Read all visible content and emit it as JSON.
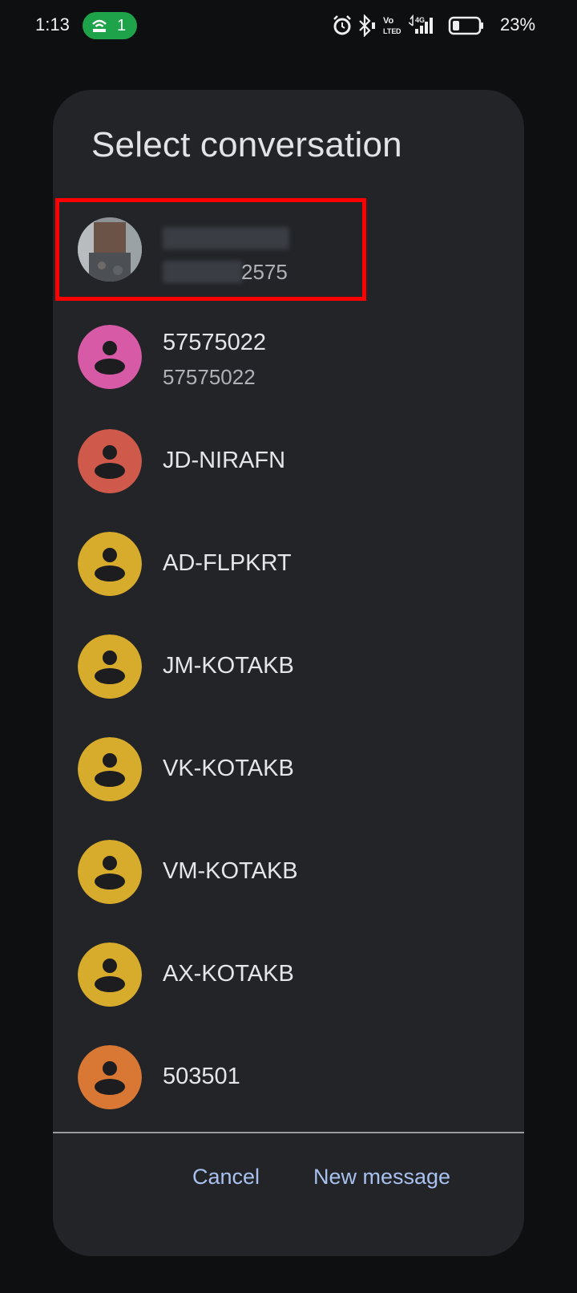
{
  "status_bar": {
    "time": "1:13",
    "hotspot_count": "1",
    "battery_percent": "23%",
    "icons": [
      "alarm-icon",
      "bluetooth-icon",
      "volte-icon",
      "4g-signal-icon",
      "battery-icon"
    ],
    "colors": {
      "hotspot_badge": "#1fa34a"
    }
  },
  "dialog": {
    "title": "Select conversation",
    "conversations": [
      {
        "name": "",
        "subtitle": "2575",
        "avatar": "photo",
        "highlighted": true
      },
      {
        "name": "57575022",
        "subtitle": "57575022",
        "avatar_color": "#d75aa6"
      },
      {
        "name": "JD-NIRAFN",
        "avatar_color": "#cf5a4c"
      },
      {
        "name": "AD-FLPKRT",
        "avatar_color": "#d7ab2b"
      },
      {
        "name": "JM-KOTAKB",
        "avatar_color": "#d7ab2b"
      },
      {
        "name": "VK-KOTAKB",
        "avatar_color": "#d7ab2b"
      },
      {
        "name": "VM-KOTAKB",
        "avatar_color": "#d7ab2b"
      },
      {
        "name": "AX-KOTAKB",
        "avatar_color": "#d7ab2b"
      },
      {
        "name": "503501",
        "avatar_color": "#d87834"
      }
    ],
    "cancel_label": "Cancel",
    "new_message_label": "New message",
    "colors": {
      "background": "#222428",
      "button_text": "#a9c1ef",
      "highlight_box": "#ff0000"
    }
  }
}
